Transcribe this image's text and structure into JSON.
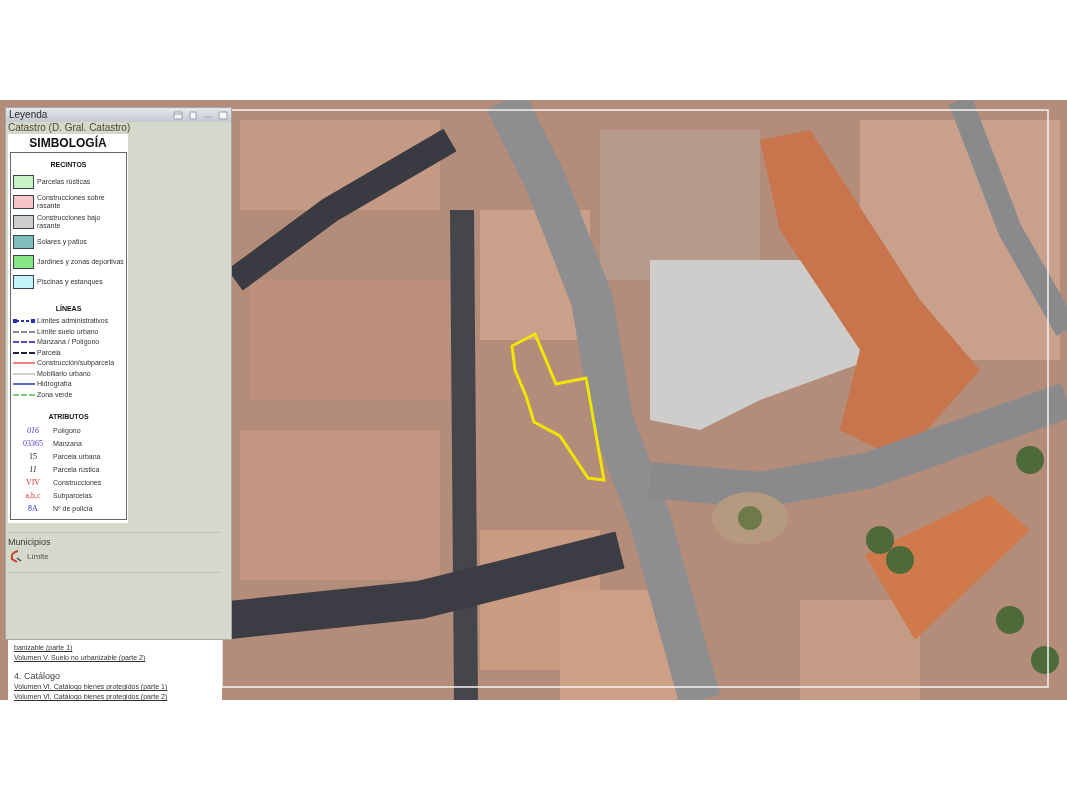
{
  "legend_window": {
    "title": "Leyenda",
    "source": "Catastro (D. Gral. Catastro)",
    "heading": "SIMBOLOGÍA",
    "recintos": {
      "title": "RECINTOS",
      "items": [
        {
          "label": "Parcelas rústicas",
          "color": "#c6f2c6"
        },
        {
          "label": "Construcciones sobre rasante",
          "color": "#f6c6c6"
        },
        {
          "label": "Construcciones bajo rasante",
          "color": "#cfcfcf"
        },
        {
          "label": "Solares y patios",
          "color": "#7fbcbc"
        },
        {
          "label": "Jardines y zonas deportivas",
          "color": "#86e686"
        },
        {
          "label": "Piscinas y estanques",
          "color": "#c4f4fa"
        }
      ]
    },
    "lineas": {
      "title": "LÍNEAS",
      "items": [
        {
          "label": "Límites administrativos",
          "color": "#2a2aa8",
          "kind": "dotted"
        },
        {
          "label": "Límite suelo urbano",
          "color": "#8a8a8a",
          "kind": "dashed"
        },
        {
          "label": "Manzana / Polígono",
          "color": "#5a4ad0",
          "kind": "dashed"
        },
        {
          "label": "Parcela",
          "color": "#202040",
          "kind": "dashed"
        },
        {
          "label": "Construcción/subparcela",
          "color": "#f08080",
          "kind": "solid"
        },
        {
          "label": "Mobiliario urbano",
          "color": "#d0d0d0",
          "kind": "solid"
        },
        {
          "label": "Hidrografía",
          "color": "#5a6ad0",
          "kind": "solid"
        },
        {
          "label": "Zona verde",
          "color": "#7ad07a",
          "kind": "dashed"
        }
      ]
    },
    "atributos": {
      "title": "ATRIBUTOS",
      "items": [
        {
          "sample": "016",
          "label": "Polígono",
          "kind": "polygon"
        },
        {
          "sample": "03365",
          "label": "Manzana",
          "kind": "block"
        },
        {
          "sample": "15",
          "label": "Parcela urbana",
          "kind": "urban"
        },
        {
          "sample": "11",
          "label": "Parcela rústica",
          "kind": "rural"
        },
        {
          "sample": "VIV",
          "label": "Construcciones",
          "kind": "building"
        },
        {
          "sample": "a,b,c",
          "label": "Subparcelas",
          "kind": "subparcel"
        },
        {
          "sample": "8A",
          "label": "Nº de policía",
          "kind": "number"
        }
      ]
    },
    "municipios": {
      "title": "Municipios",
      "items": [
        {
          "label": "Límite"
        }
      ]
    }
  },
  "document_links": [
    {
      "text": "banizable (parte 1)",
      "kind": "link"
    },
    {
      "text": "Volumen V. Suelo no urbanizable (parte 2)",
      "kind": "link"
    },
    {
      "text": "4. Catálogo",
      "kind": "heading"
    },
    {
      "text": "Volumen VI. Catálogo bienes protegidos (parte 1)",
      "kind": "link"
    },
    {
      "text": "Volumen VI. Catálogo bienes protegidos (parte 2)",
      "kind": "link"
    }
  ]
}
